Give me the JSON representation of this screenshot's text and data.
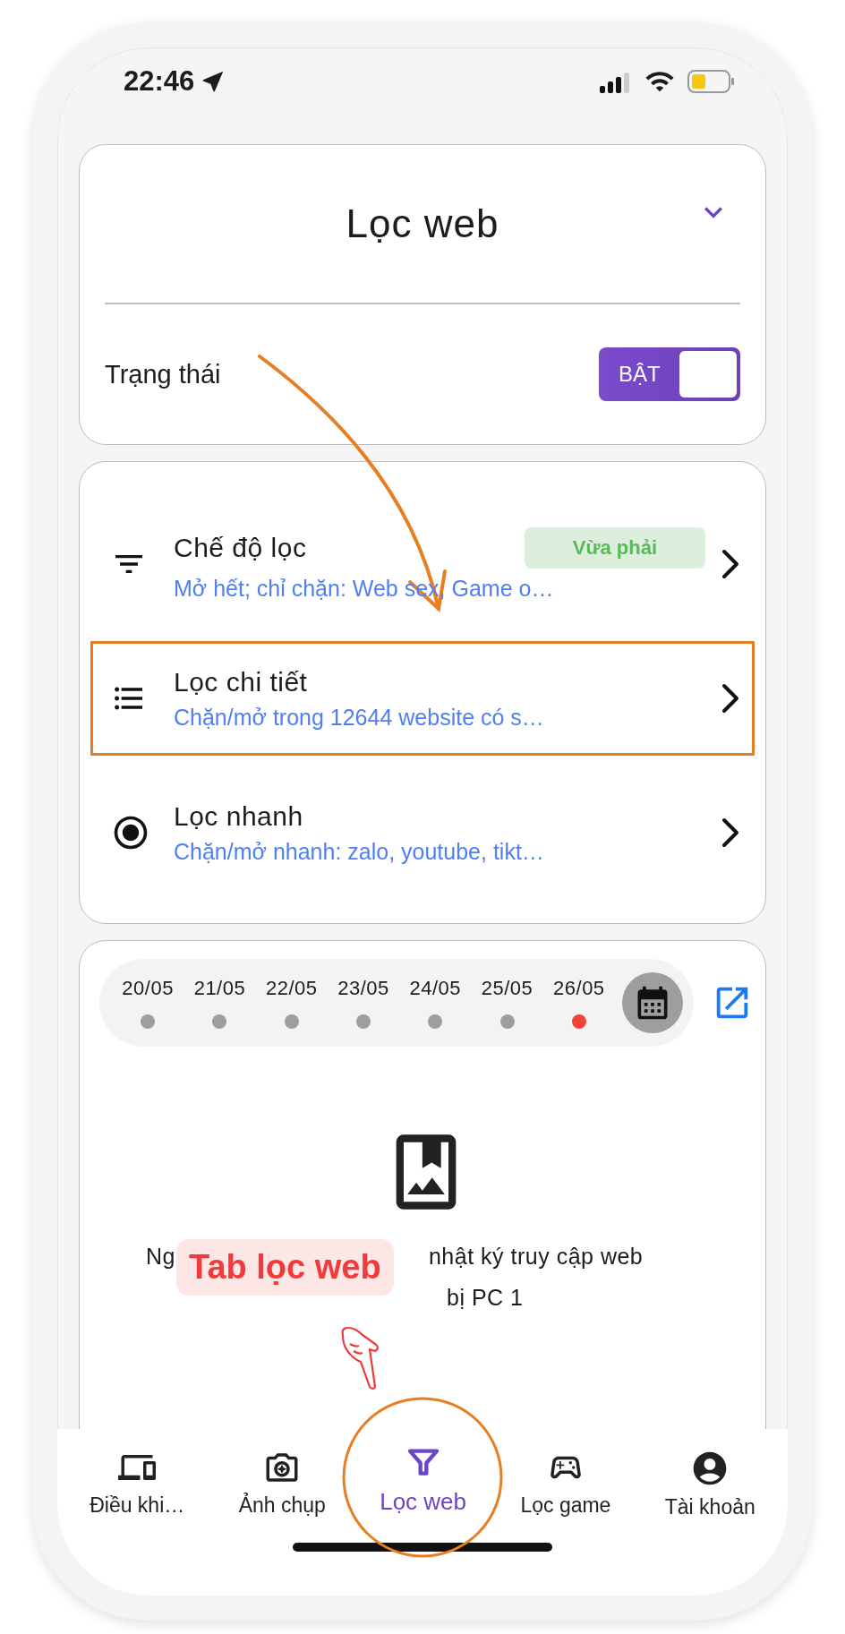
{
  "status_bar": {
    "time": "22:46"
  },
  "header_card": {
    "title": "Lọc web",
    "status_label": "Trạng thái",
    "toggle": {
      "label": "BẬT",
      "on": true
    }
  },
  "filter_items": [
    {
      "kind": "filter",
      "title": "Chế độ lọc",
      "subtitle": "Mở hết; chỉ chặn: Web sex, Game o…",
      "badge": "Vừa phải",
      "highlighted": false
    },
    {
      "kind": "list",
      "title": "Lọc chi tiết",
      "subtitle": "Chặn/mở trong 12644 website có s…",
      "highlighted": true
    },
    {
      "kind": "radio",
      "title": "Lọc nhanh",
      "subtitle": "Chặn/mở nhanh: zalo, youtube, tikt…",
      "highlighted": false
    }
  ],
  "date_strip": [
    {
      "label": "20/05",
      "selected": false
    },
    {
      "label": "21/05",
      "selected": false
    },
    {
      "label": "22/05",
      "selected": false
    },
    {
      "label": "23/05",
      "selected": false
    },
    {
      "label": "24/05",
      "selected": false
    },
    {
      "label": "25/05",
      "selected": false
    },
    {
      "label": "26/05",
      "selected": true
    }
  ],
  "empty_state": {
    "line_1_start": "Ng",
    "line_1_end": "nhật ký truy cập web",
    "line_2_end": "bị PC 1"
  },
  "annotation": {
    "callout": "Tab lọc web"
  },
  "bottom_nav": [
    {
      "kind": "devices",
      "label": "Điều khi…",
      "selected": false
    },
    {
      "kind": "camera",
      "label": "Ảnh chụp",
      "selected": false
    },
    {
      "kind": "funnel",
      "label": "Lọc web",
      "selected": true
    },
    {
      "kind": "gamepad",
      "label": "Lọc game",
      "selected": false
    },
    {
      "kind": "account",
      "label": "Tài khoản",
      "selected": false
    }
  ]
}
